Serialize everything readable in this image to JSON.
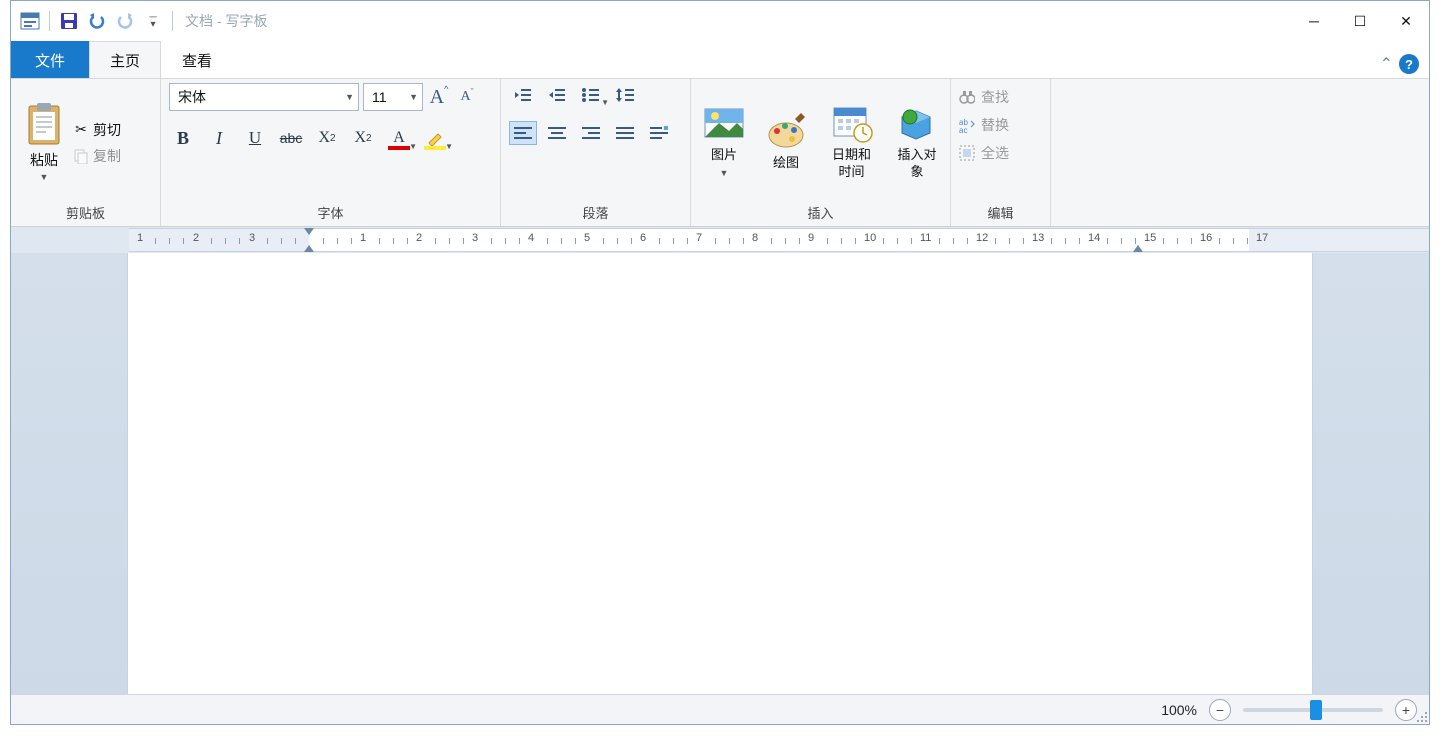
{
  "title": "文档 - 写字板",
  "tabs": {
    "file": "文件",
    "home": "主页",
    "view": "查看"
  },
  "groups": {
    "clipboard": {
      "label": "剪贴板",
      "paste": "粘贴",
      "cut": "剪切",
      "copy": "复制"
    },
    "font": {
      "label": "字体",
      "name": "宋体",
      "size": "11"
    },
    "paragraph": {
      "label": "段落"
    },
    "insert": {
      "label": "插入",
      "picture": "图片",
      "paint": "绘图",
      "datetime": "日期和时间",
      "object": "插入对象"
    },
    "edit": {
      "label": "编辑",
      "find": "查找",
      "replace": "替换",
      "selectall": "全选"
    }
  },
  "ruler": {
    "left": [
      "3",
      "2",
      "1"
    ],
    "right": [
      "1",
      "2",
      "3",
      "4",
      "5",
      "6",
      "7",
      "8",
      "9",
      "10",
      "11",
      "12",
      "13",
      "14",
      "15",
      "16",
      "17"
    ]
  },
  "status": {
    "zoom": "100%"
  }
}
